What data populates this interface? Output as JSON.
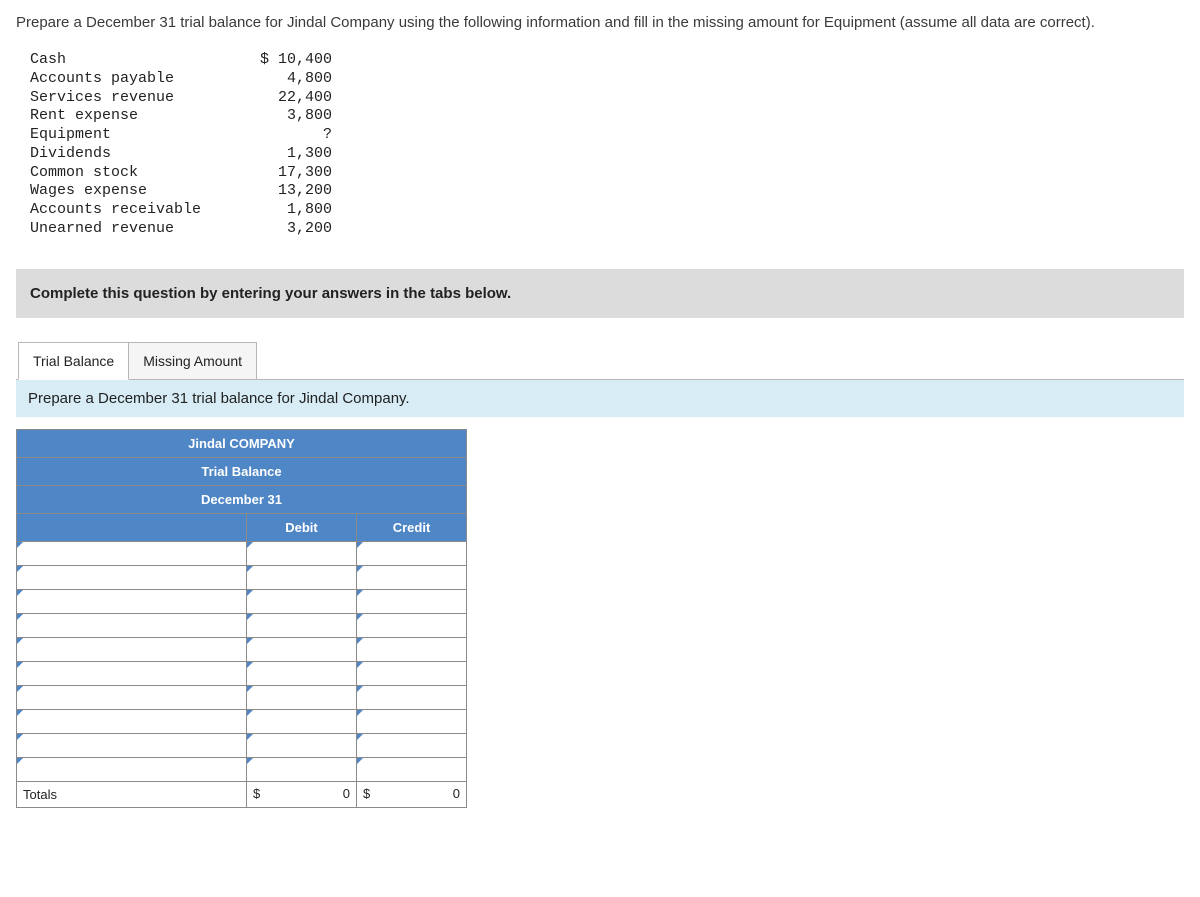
{
  "question": "Prepare a December 31 trial balance for Jindal Company using the following information and fill in the missing amount for Equipment (assume all data are correct).",
  "accounts": [
    {
      "label": "Cash",
      "value": "$ 10,400"
    },
    {
      "label": "Accounts payable",
      "value": "4,800"
    },
    {
      "label": "Services revenue",
      "value": "22,400"
    },
    {
      "label": "Rent expense",
      "value": "3,800"
    },
    {
      "label": "Equipment",
      "value": "?"
    },
    {
      "label": "Dividends",
      "value": "1,300"
    },
    {
      "label": "Common stock",
      "value": "17,300"
    },
    {
      "label": "Wages expense",
      "value": "13,200"
    },
    {
      "label": "Accounts receivable",
      "value": "1,800"
    },
    {
      "label": "Unearned revenue",
      "value": "3,200"
    }
  ],
  "instruction": "Complete this question by entering your answers in the tabs below.",
  "tabs": {
    "trial_balance": "Trial Balance",
    "missing_amount": "Missing Amount"
  },
  "sub_instruction": "Prepare a December 31 trial balance for Jindal Company.",
  "worksheet": {
    "company": "Jindal COMPANY",
    "title": "Trial Balance",
    "date": "December 31",
    "col_debit": "Debit",
    "col_credit": "Credit",
    "num_rows": 10,
    "totals_label": "Totals",
    "currency": "$",
    "debit_total": "0",
    "credit_total": "0"
  }
}
